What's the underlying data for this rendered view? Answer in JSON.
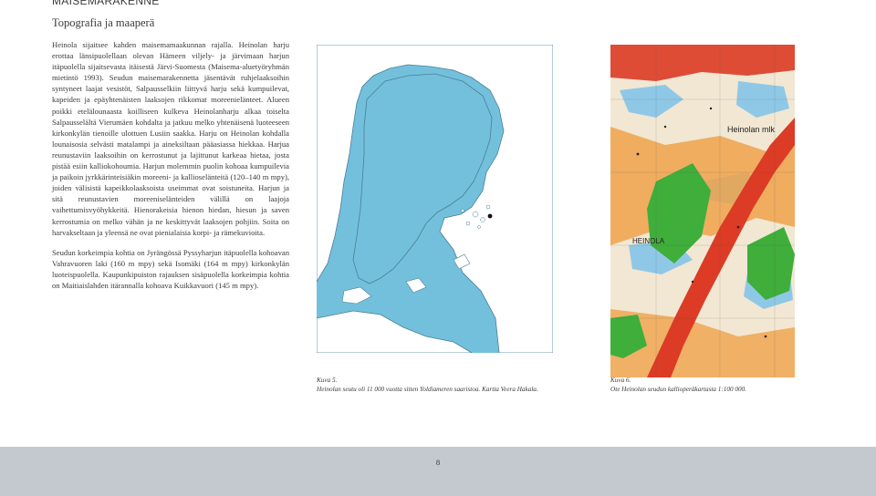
{
  "header": {
    "section_title": "MAISEMARAKENNE",
    "subtitle": "Topografia ja maaperä"
  },
  "body": {
    "paragraphs": [
      "Heinola sijaitsee kahden maisemamaakunnan rajalla. Heinolan harju erottaa länsipuolellaan olevan Hämeen viljely- ja järvimaan harjun itäpuolella sijaitsevasta itäisestä Järvi-Suomesta (Maisema-aluetyöryhmän mietintö 1993). Seudun maisemarakennetta jäsentävät ruhjelaaksoihin syntyneet laajat vesistöt, Salpausselkiin liittyvä harju sekä kumpuilevat, kapeiden ja epäyhtenäisten laaksojen rikkomat moreenielänteet. Alueen poikki etelälounaasta koilliseen kulkeva Heinolanharju alkaa toiselta Salpausselältä Vierumäen kohdalta ja jatkuu melko yhtenäisenä luoteeseen kirkonkylän tienoille ulottuen Lusiin saakka. Harju on Heinolan kohdalla lounaisosia selvästi matalampi ja aineksiltaan pääasiassa hiekkaa. Harjua reunustaviin laaksoihin on kerrostunut ja lajittunut karkeaa hietaa, josta pistää esiin kalliokohoumia. Harjun molemmin puolin kohoaa kumpuilevia ja paikoin jyrkkärinteisiäkin moreeni- ja kallioselänteitä (120–140 m mpy), joiden välisistä kapeikkolaaksoista useimmat ovat soistuneita. Harjun ja sitä reunustavien moreeniselänteiden välillä on laajoja vaihettumisvyöhykkeitä. Hienorakeisia hienon hiedan, hiesun ja saven kerrostumia on melko vähän ja ne keskittyvät laaksojen pohjiin. Soita on harvakseltaan ja yleensä ne ovat pienialaisia korpi- ja rämekuvioita.",
      "Seudun korkeimpia kohtia on Jyrängössä Pyssyharjun itäpuolella kohoavan Vahravuoren laki (160 m mpy) sekä Isomäki (164 m mpy) kirkonkylän luoteispuolella. Kaupunkipuiston rajauksen sisäpuolella korkeimpia kohtia on Maitiaislahden itärannalla kohoava Kuikkavuori (145 m mpy)."
    ]
  },
  "figures": {
    "fig5": {
      "caption_label": "Kuva 5.",
      "caption_text": "Heinolan seutu oli 11 000 vuotta sitten Yoldiameren saaristoa. Kartta Veera Hakala.",
      "colors": {
        "sea": "#73c0dc",
        "land": "#ffffff",
        "coast": "#4a7f94"
      }
    },
    "fig6": {
      "caption_label": "Kuva 6.",
      "caption_text": "Ote Heinolan seudun kallioperäkartasta 1:100 000.",
      "map_labels": {
        "mlk": "Heinolan mlk",
        "town": "HEINOLA"
      },
      "colors": {
        "base": "#f1e7d3",
        "red": "#dc3b25",
        "green": "#3fae3a",
        "orange": "#f0a24a",
        "lake": "#8fc8e6"
      }
    }
  },
  "footer": {
    "page_number": "8"
  }
}
